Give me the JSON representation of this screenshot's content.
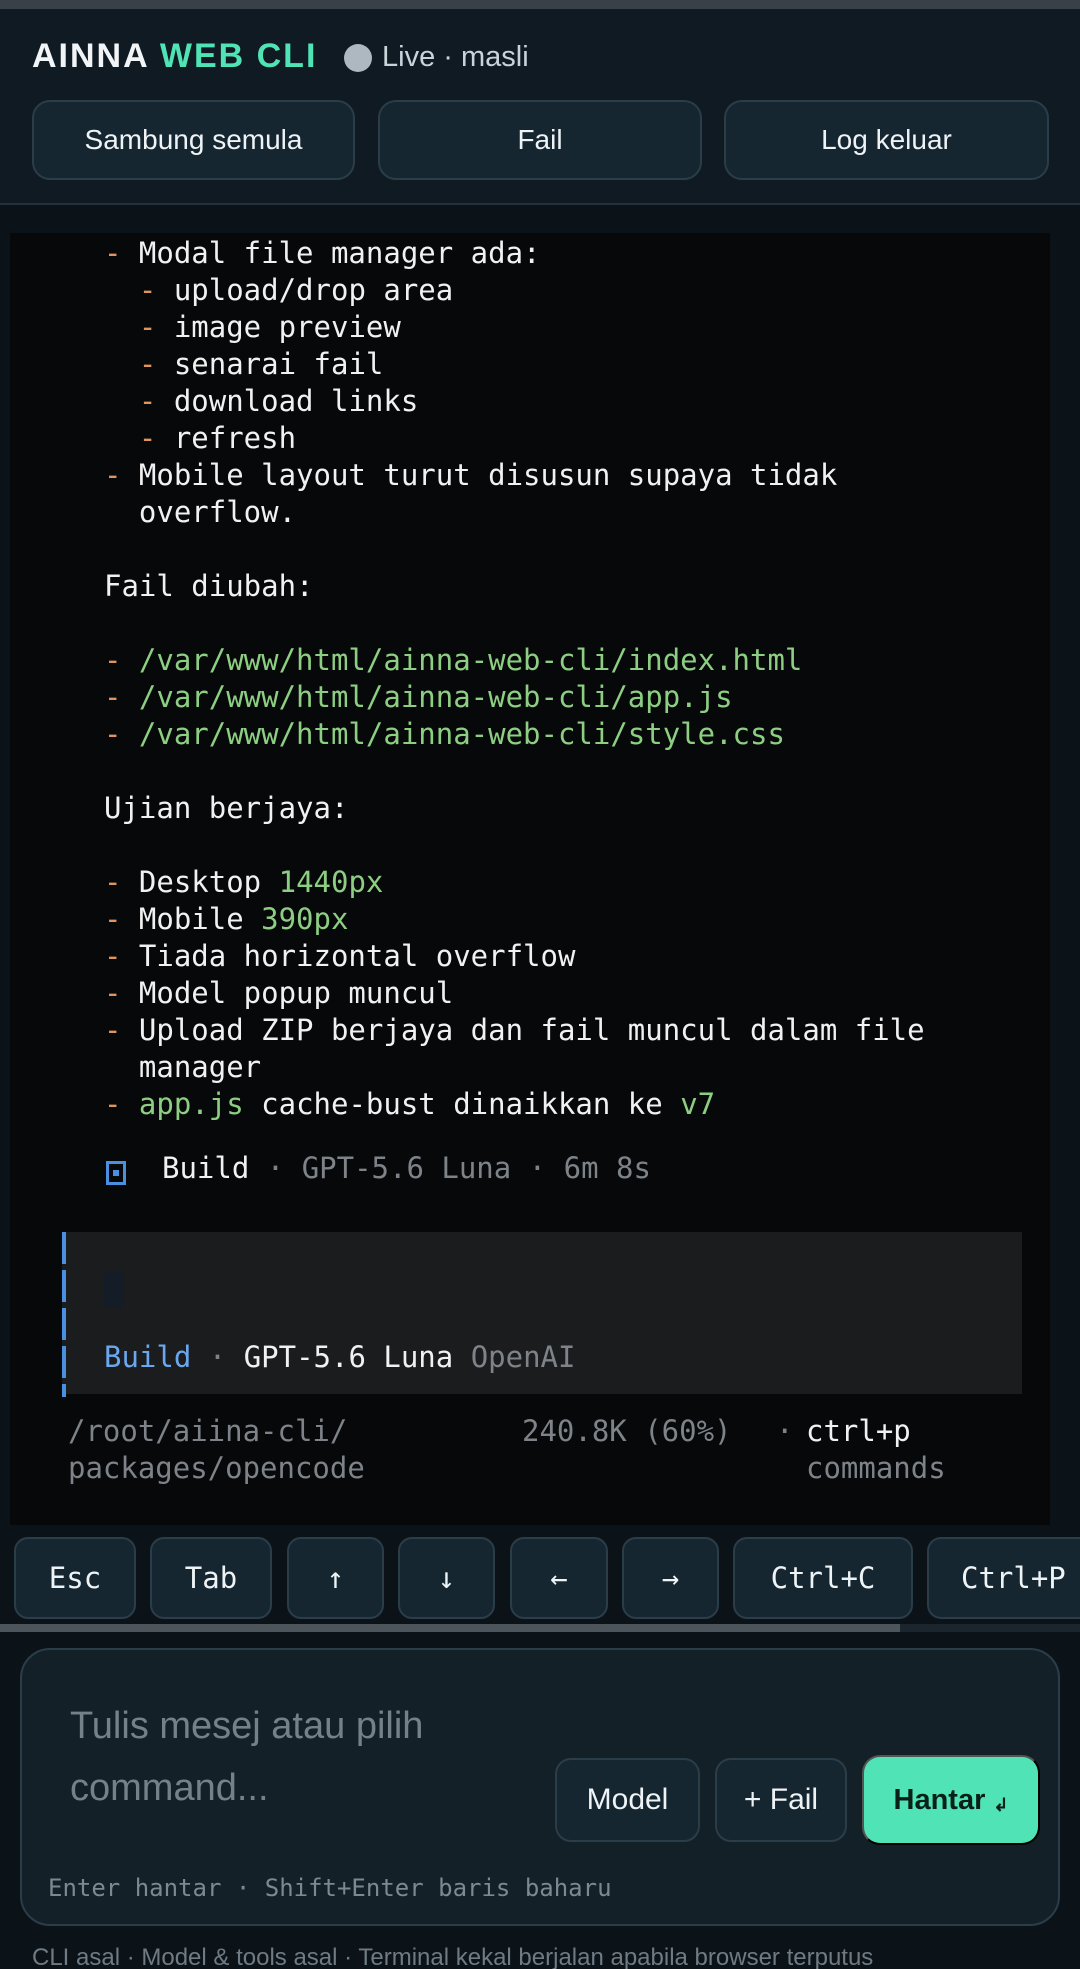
{
  "header": {
    "brand_part1": "AINNA",
    "brand_part2": "WEB CLI",
    "status_text": "Live · masli",
    "buttons": [
      "Sambung semula",
      "Fail",
      "Log keluar"
    ]
  },
  "terminal": {
    "lines": [
      {
        "segs": [
          {
            "t": "- ",
            "c": "org"
          },
          {
            "t": "Modal file manager ada:",
            "c": "wht"
          }
        ]
      },
      {
        "segs": [
          {
            "t": "  - ",
            "c": "org"
          },
          {
            "t": "upload/drop area",
            "c": "wht"
          }
        ]
      },
      {
        "segs": [
          {
            "t": "  - ",
            "c": "org"
          },
          {
            "t": "image preview",
            "c": "wht"
          }
        ]
      },
      {
        "segs": [
          {
            "t": "  - ",
            "c": "org"
          },
          {
            "t": "senarai fail",
            "c": "wht"
          }
        ]
      },
      {
        "segs": [
          {
            "t": "  - ",
            "c": "org"
          },
          {
            "t": "download links",
            "c": "wht"
          }
        ]
      },
      {
        "segs": [
          {
            "t": "  - ",
            "c": "org"
          },
          {
            "t": "refresh",
            "c": "wht"
          }
        ]
      },
      {
        "segs": [
          {
            "t": "- ",
            "c": "org"
          },
          {
            "t": "Mobile layout turut disusun supaya tidak",
            "c": "wht"
          }
        ]
      },
      {
        "segs": [
          {
            "t": "  overflow.",
            "c": "wht"
          }
        ]
      },
      {
        "segs": []
      },
      {
        "segs": [
          {
            "t": "Fail diubah:",
            "c": "wht"
          }
        ]
      },
      {
        "segs": []
      },
      {
        "segs": [
          {
            "t": "- ",
            "c": "org"
          },
          {
            "t": "/var/www/html/ainna-web-cli/index.html",
            "c": "grn"
          }
        ]
      },
      {
        "segs": [
          {
            "t": "- ",
            "c": "org"
          },
          {
            "t": "/var/www/html/ainna-web-cli/app.js",
            "c": "grn"
          }
        ]
      },
      {
        "segs": [
          {
            "t": "- ",
            "c": "org"
          },
          {
            "t": "/var/www/html/ainna-web-cli/style.css",
            "c": "grn"
          }
        ]
      },
      {
        "segs": []
      },
      {
        "segs": [
          {
            "t": "Ujian berjaya:",
            "c": "wht"
          }
        ]
      },
      {
        "segs": []
      },
      {
        "segs": [
          {
            "t": "- ",
            "c": "org"
          },
          {
            "t": "Desktop ",
            "c": "wht"
          },
          {
            "t": "1440px",
            "c": "grn"
          }
        ]
      },
      {
        "segs": [
          {
            "t": "- ",
            "c": "org"
          },
          {
            "t": "Mobile ",
            "c": "wht"
          },
          {
            "t": "390px",
            "c": "grn"
          }
        ]
      },
      {
        "segs": [
          {
            "t": "- ",
            "c": "org"
          },
          {
            "t": "Tiada horizontal overflow",
            "c": "wht"
          }
        ]
      },
      {
        "segs": [
          {
            "t": "- ",
            "c": "org"
          },
          {
            "t": "Model popup muncul",
            "c": "wht"
          }
        ]
      },
      {
        "segs": [
          {
            "t": "- ",
            "c": "org"
          },
          {
            "t": "Upload ZIP berjaya dan fail muncul dalam file",
            "c": "wht"
          }
        ]
      },
      {
        "segs": [
          {
            "t": "  manager",
            "c": "wht"
          }
        ]
      },
      {
        "segs": [
          {
            "t": "- ",
            "c": "org"
          },
          {
            "t": "app.js",
            "c": "grn"
          },
          {
            "t": " cache-bust dinaikkan ke ",
            "c": "wht"
          },
          {
            "t": "v7",
            "c": "grn"
          }
        ]
      }
    ],
    "build_summary": {
      "mode": "Build",
      "sep": " · ",
      "model": "GPT-5.6 Luna",
      "duration": "6m 8s"
    },
    "prompt": {
      "mode": "Build",
      "sep": " · ",
      "model": "GPT-5.6 Luna",
      "provider": "OpenAI"
    },
    "status_path_1": "/root/aiina-cli/",
    "status_path_2": "packages/opencode",
    "status_tokens": "240.8K (60%)",
    "status_dot": "·",
    "status_cmd_1": "ctrl+p",
    "status_cmd_2": "commands"
  },
  "keys": [
    "Esc",
    "Tab",
    "↑",
    "↓",
    "←",
    "→",
    "Ctrl+C",
    "Ctrl+P"
  ],
  "composer": {
    "placeholder": "Tulis mesej atau pilih command...",
    "model_button": "Model",
    "file_button": "+ Fail",
    "send_button": "Hantar",
    "send_icon": "↲",
    "hint": "Enter hantar · Shift+Enter baris baharu"
  },
  "footer": "CLI asal · Model & tools asal · Terminal kekal berjalan apabila browser terputus"
}
